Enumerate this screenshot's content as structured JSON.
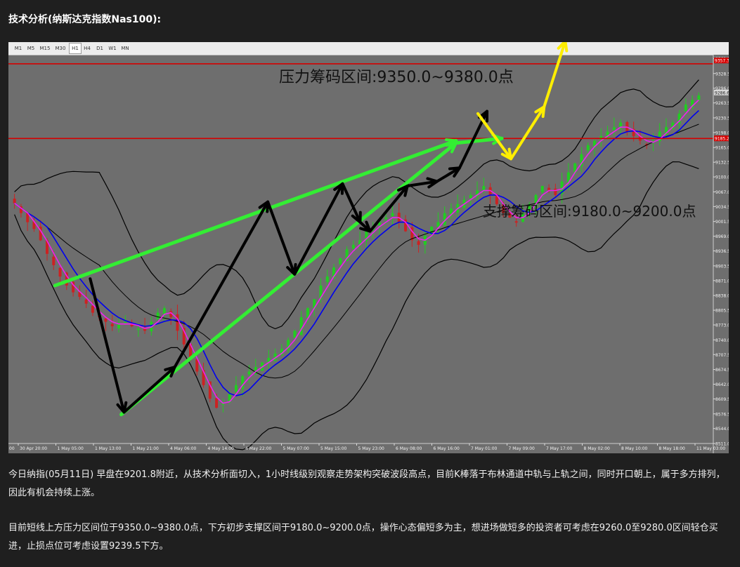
{
  "title": "技术分析(纳斯达克指数Nas100):",
  "timeframes": [
    "M1",
    "M5",
    "M15",
    "M30",
    "H1",
    "H4",
    "D1",
    "W1",
    "MN"
  ],
  "active_timeframe": "H1",
  "annotations": {
    "resistance": "压力筹码区间:9350.0~9380.0点",
    "support": "支撑筹码区间:9180.0~9200.0点"
  },
  "price_tags": {
    "top": "9357.3",
    "mid": "9286.6",
    "low": "9185.2"
  },
  "colors": {
    "resistance_line": "#d40000",
    "trend_green": "#33ee33",
    "wave_black": "#000000",
    "wave_yellow": "#ffee00",
    "ma_blue": "#0000ee",
    "band_black": "#000000",
    "candle_up": "#22cc22",
    "candle_down": "#cc2222",
    "ma_magenta": "#ee22ee"
  },
  "chart_data": {
    "type": "candlestick",
    "symbol": "Nas100",
    "timeframe": "H1",
    "y_ticks": [
      "9361.5",
      "9328.5",
      "9296.0",
      "9263.5",
      "9230.5",
      "9198.0",
      "9165.0",
      "9132.5",
      "9100.0",
      "9067.0",
      "9034.5",
      "9001.5",
      "8969.0",
      "8936.5",
      "8903.5",
      "8871.0",
      "8838.0",
      "8805.5",
      "8773.0",
      "8740.0",
      "8707.5",
      "8674.5",
      "8642.0",
      "8609.5",
      "8576.5",
      "8544.0",
      "8511.0"
    ],
    "ylim": [
      8511.0,
      9370.0
    ],
    "x_ticks": [
      "30 Apr 20:00",
      "1 May 05:00",
      "1 May 13:00",
      "1 May 21:00",
      "4 May 06:00",
      "4 May 14:00",
      "4 May 22:00",
      "5 May 07:00",
      "5 May 15:00",
      "5 May 23:00",
      "6 May 08:00",
      "6 May 16:00",
      "7 May 01:00",
      "7 May 09:00",
      "7 May 17:00",
      "8 May 02:00",
      "8 May 10:00",
      "8 May 18:00",
      "11 May 03:00"
    ],
    "x_edge_label": "00",
    "horizontal_lines": [
      {
        "name": "resistance",
        "value": 9350.0
      },
      {
        "name": "support",
        "value": 9185.0
      }
    ],
    "close": [
      9042,
      9020,
      9000,
      8985,
      8960,
      8930,
      8905,
      8880,
      8860,
      8845,
      8835,
      8820,
      8800,
      8790,
      8780,
      8770,
      8775,
      8780,
      8770,
      8765,
      8760,
      8780,
      8800,
      8810,
      8790,
      8760,
      8730,
      8700,
      8670,
      8640,
      8610,
      8590,
      8600,
      8620,
      8640,
      8660,
      8670,
      8680,
      8690,
      8700,
      8710,
      8720,
      8740,
      8760,
      8790,
      8810,
      8830,
      8860,
      8880,
      8900,
      8920,
      8940,
      8950,
      8960,
      8980,
      8990,
      9000,
      9010,
      9020,
      9000,
      8980,
      8960,
      8950,
      8970,
      8990,
      9000,
      9020,
      9030,
      9040,
      9050,
      9060,
      9070,
      9080,
      9060,
      9040,
      9020,
      9010,
      9000,
      9020,
      9040,
      9060,
      9080,
      9070,
      9060,
      9090,
      9110,
      9130,
      9150,
      9170,
      9180,
      9190,
      9200,
      9210,
      9220,
      9200,
      9190,
      9180,
      9170,
      9180,
      9200,
      9210,
      9220,
      9240,
      9260,
      9270,
      9280
    ],
    "wave_black_points": [
      [
        0.116,
        8875
      ],
      [
        0.164,
        8580
      ],
      [
        0.236,
        8680
      ],
      [
        0.368,
        9045
      ],
      [
        0.406,
        8885
      ],
      [
        0.474,
        9085
      ],
      [
        0.499,
        9000
      ],
      [
        0.513,
        8980
      ],
      [
        0.566,
        9080
      ],
      [
        0.608,
        9090
      ],
      [
        0.64,
        9120
      ],
      [
        0.679,
        9245
      ]
    ],
    "wave_yellow_points": [
      [
        0.666,
        9240
      ],
      [
        0.713,
        9140
      ],
      [
        0.76,
        9255
      ],
      [
        0.79,
        9400
      ]
    ],
    "green_trend_upper": [
      [
        0.066,
        8860
      ],
      [
        0.635,
        9180
      ]
    ],
    "green_trend_lower": [
      [
        0.16,
        8575
      ],
      [
        0.635,
        9175
      ],
      [
        0.7,
        9185
      ]
    ]
  },
  "paragraphs": [
    "今日纳指(05月11日) 早盘在9201.8附近，从技术分析面切入，1小时线级别观察走势架构突破波段高点，目前K棒落于布林通道中轨与上轨之间，同时开口朝上，属于多方排列，因此有机会持续上涨。",
    "目前短线上方压力区间位于9350.0~9380.0点，下方初步支撑区间于9180.0~9200.0点，操作心态偏短多为主，想进场做短多的投资者可考虑在9260.0至9280.0区间轻仓买进，止损点位可考虑设置9239.5下方。"
  ]
}
